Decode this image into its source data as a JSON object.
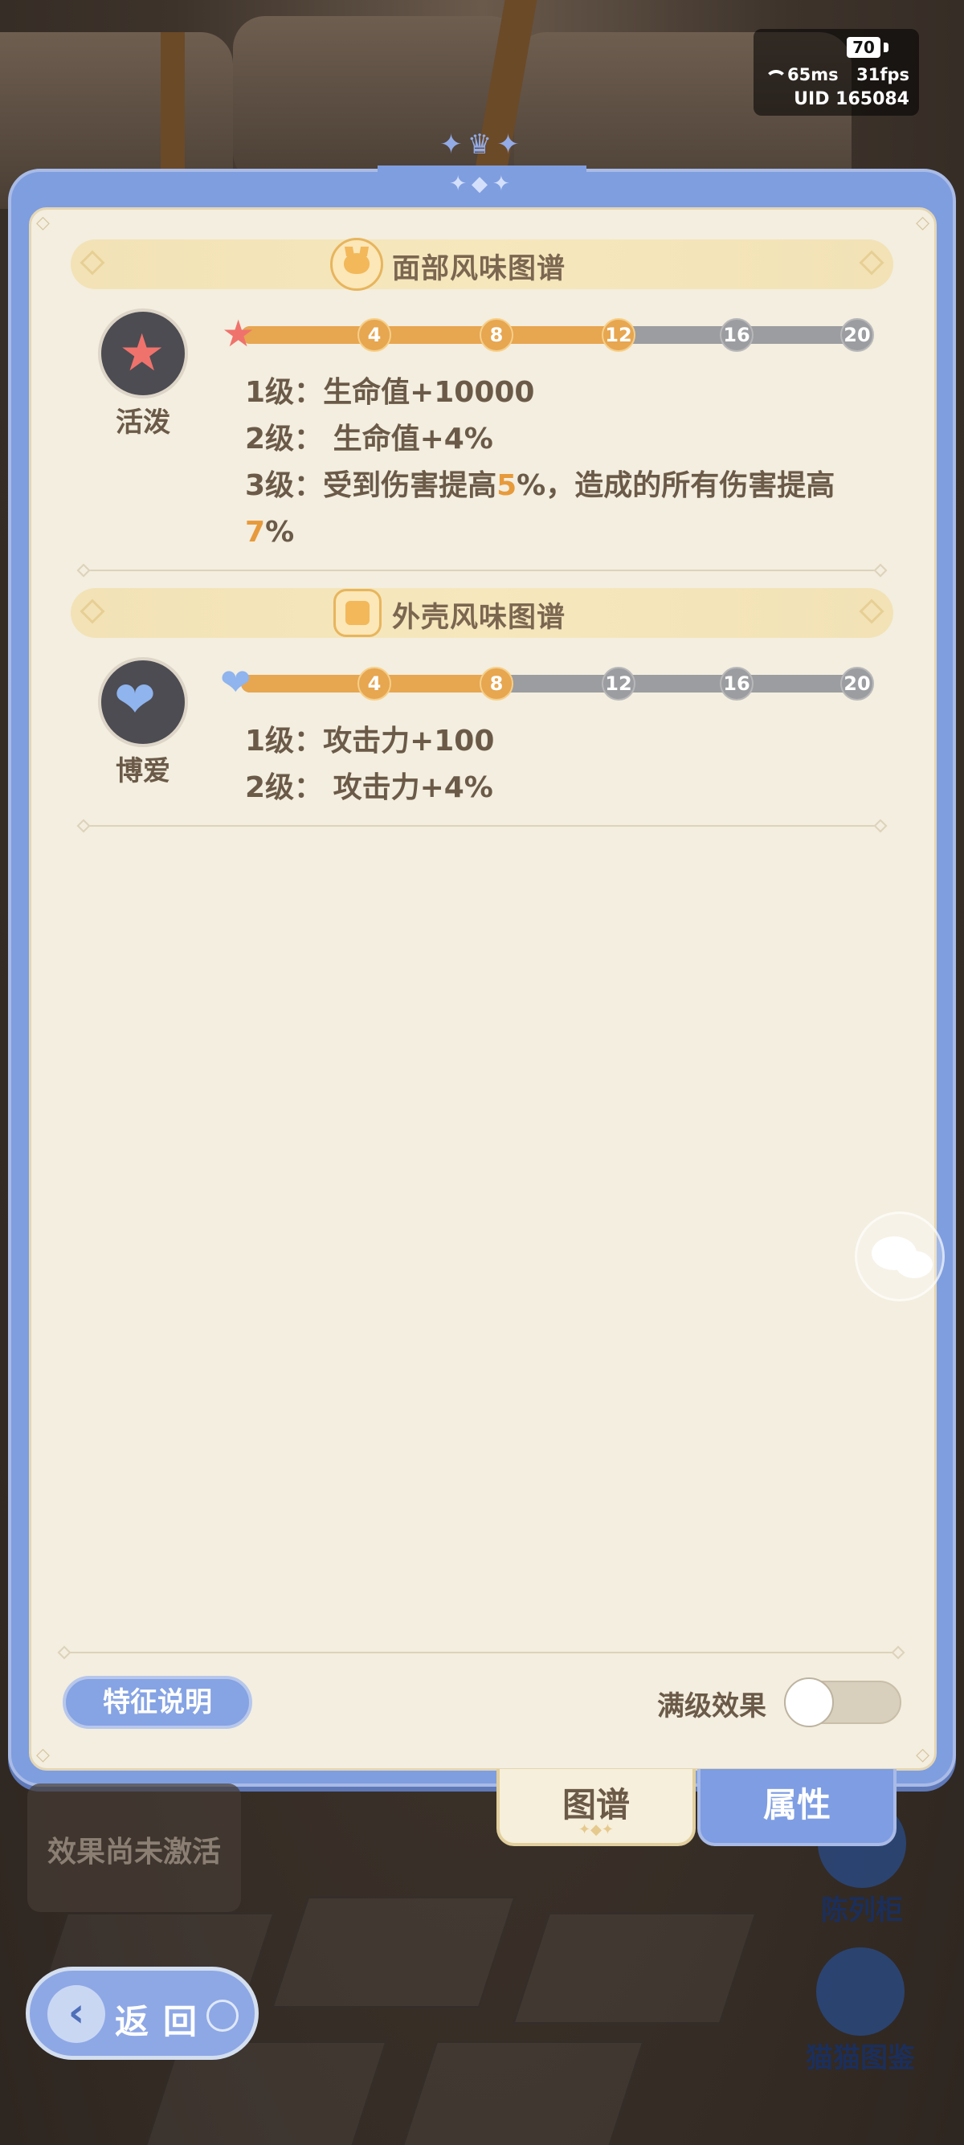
{
  "status": {
    "battery": "70",
    "ping": "65ms",
    "fps": "31fps",
    "uid": "UID 165084"
  },
  "sections": [
    {
      "title": "面部风味图谱",
      "icon": "cat-face-icon",
      "trait_name": "活泼",
      "trait_icon": "star-face-icon",
      "level": 12,
      "milestones": [
        "4",
        "8",
        "12",
        "16",
        "20"
      ],
      "effects": [
        {
          "prefix": "1级：",
          "text": "生命值+10000"
        },
        {
          "prefix": "2级：",
          "text": " 生命值+4%"
        },
        {
          "prefix": "3级：",
          "text": "受到伤害提高",
          "hl1": "5",
          "mid": "%，造成的所有伤害提高",
          "hl2": "7",
          "end": "%"
        }
      ]
    },
    {
      "title": "外壳风味图谱",
      "icon": "shell-icon",
      "trait_name": "博爱",
      "trait_icon": "hearts-icon",
      "level": 8,
      "milestones": [
        "4",
        "8",
        "12",
        "16",
        "20"
      ],
      "effects": [
        {
          "prefix": "1级：",
          "text": "攻击力+100"
        },
        {
          "prefix": "2级：",
          "text": " 攻击力+4%"
        }
      ]
    }
  ],
  "footer": {
    "feature_button": "特征说明",
    "toggle_label": "满级效果",
    "toggle_on": false
  },
  "tabs": [
    {
      "label": "图谱",
      "active": false
    },
    {
      "label": "属性",
      "active": true
    }
  ],
  "background": {
    "inactive_text": "效果尚未激活",
    "side_buttons": [
      "陈列柜",
      "猫猫图鉴"
    ],
    "back_label": "返回"
  },
  "colors": {
    "accent_orange": "#e7a650",
    "panel_blue": "#7f9ee0",
    "paper": "#f3eedf"
  }
}
